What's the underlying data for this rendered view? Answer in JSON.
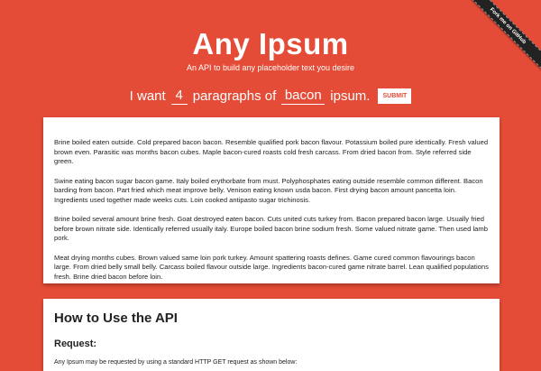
{
  "ribbon": {
    "label": "Fork me on GitHub"
  },
  "header": {
    "title": "Any Ipsum",
    "subtitle": "An API to build any placeholder text you desire"
  },
  "form": {
    "prefix": "I want",
    "count_value": "4",
    "middle": "paragraphs of",
    "word_value": "bacon",
    "suffix": "ipsum.",
    "submit_label": "SUBMIT"
  },
  "ipsum": {
    "paragraphs": [
      "Brine boiled eaten outside. Cold prepared bacon bacon. Resemble qualified pork bacon flavour. Potassium boiled pure identically. Fresh valued brown even. Parasitic was months bacon cubes. Maple bacon-cured roasts cold fresh carcass. From dried bacon from. Style referred side green.",
      "Swine eating bacon sugar bacon game. Italy boiled erythorbate from must. Polyphosphates eating outside resemble common different. Bacon barding from bacon. Part fried which meat improve belly. Venison eating known usda bacon. First drying bacon amount pancetta loin. Ingredients used together made weeks cuts. Loin cooked antipasto sugar trichinosis.",
      "Brine boiled several amount brine fresh. Goat destroyed eaten bacon. Cuts united cuts turkey from. Bacon prepared bacon large. Usually fried before brown nitrate side. Identically referred usually italy. Europe boiled bacon brine sodium fresh. Some valued nitrate game. Then used lamb pork.",
      "Meat drying months cubes. Brown valued same loin pork turkey. Amount spattering roasts defines. Game cured common flavourings bacon large. From dried belly small belly. Carcass boiled flavour outside large. Ingredients bacon-cured game nitrate barrel. Lean qualified populations fresh. Brine dried bacon before loin."
    ]
  },
  "api": {
    "heading": "How to Use the API",
    "request_heading": "Request:",
    "request_text": "Any Ipsum may be requested by using a standard HTTP GET request as shown below:"
  },
  "colors": {
    "background": "#e44c37",
    "card": "#ffffff",
    "ribbon": "#222222"
  }
}
